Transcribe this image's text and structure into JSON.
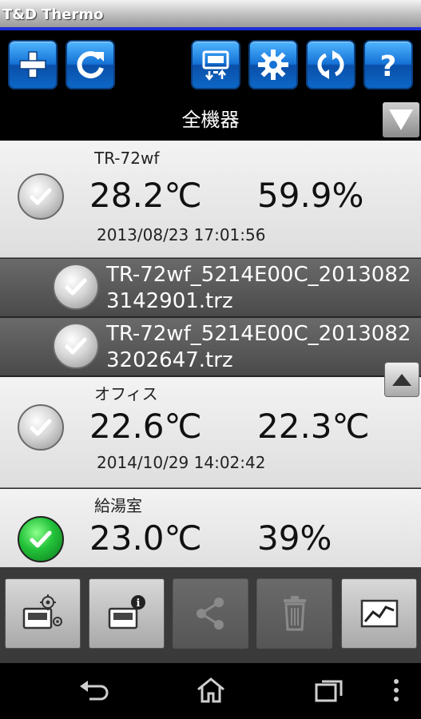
{
  "app": {
    "title": "T&D Thermo"
  },
  "toolbar": {
    "buttons": [
      {
        "name": "add-button",
        "icon": "plus-icon"
      },
      {
        "name": "refresh-button",
        "icon": "refresh-icon"
      },
      {
        "name": "transfer-button",
        "icon": "device-transfer-icon"
      },
      {
        "name": "settings-button",
        "icon": "gear-icon"
      },
      {
        "name": "sync-button",
        "icon": "sync-icon"
      },
      {
        "name": "help-button",
        "icon": "question-icon"
      }
    ]
  },
  "filter": {
    "label": "全機器"
  },
  "devices": [
    {
      "name": "TR-72wf",
      "value1": "28.2℃",
      "value2": "59.9%",
      "time": "2013/08/23 17:01:56",
      "status": "gray"
    },
    {
      "name": "オフィス",
      "value1": "22.6℃",
      "value2": "22.3℃",
      "time": "2014/10/29 14:02:42",
      "status": "gray"
    },
    {
      "name": "給湯室",
      "value1": "23.0℃",
      "value2": "39%",
      "time": "",
      "status": "green"
    }
  ],
  "files": [
    {
      "name": "TR-72wf_5214E00C_20130823142901.trz"
    },
    {
      "name": "TR-72wf_5214E00C_20130823202647.trz"
    }
  ],
  "bottom": {
    "buttons": [
      {
        "name": "device-settings-button",
        "enabled": true
      },
      {
        "name": "device-info-button",
        "enabled": true
      },
      {
        "name": "share-button",
        "enabled": false
      },
      {
        "name": "delete-button",
        "enabled": false
      },
      {
        "name": "graph-button",
        "enabled": true
      }
    ]
  },
  "colors": {
    "accent": "#1d2fd6",
    "button_blue": "#1572d6",
    "green_status": "#23c23a"
  }
}
